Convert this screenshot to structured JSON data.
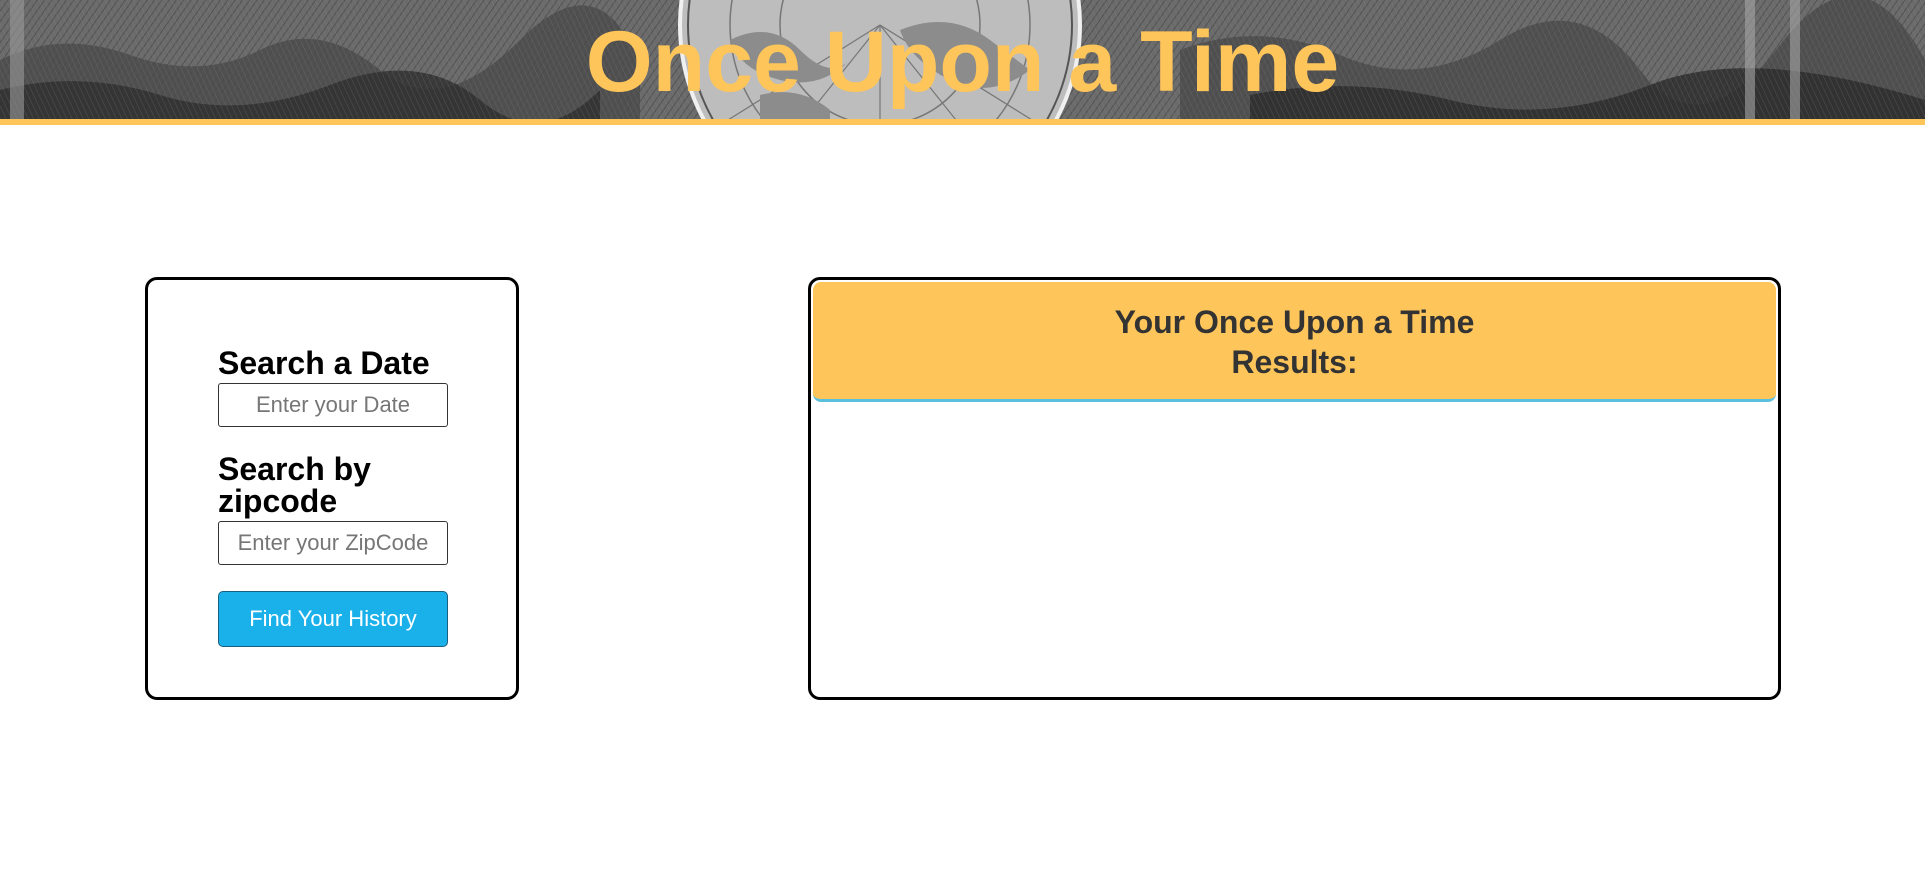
{
  "header": {
    "title": "Once Upon a Time",
    "background": "antique-world-map-engraving",
    "accent_color": "#fdc55a"
  },
  "search": {
    "date_heading": "Search a Date",
    "date_placeholder": "Enter your Date",
    "date_value": "",
    "zip_heading": "Search by zipcode",
    "zip_placeholder": "Enter your ZipCode",
    "zip_value": "",
    "button_label": "Find Your History",
    "button_color": "#1ab0ea"
  },
  "results": {
    "title_line1": "Your Once Upon a Time",
    "title_line2": "Results:",
    "header_color": "#fdc55a",
    "items": []
  }
}
